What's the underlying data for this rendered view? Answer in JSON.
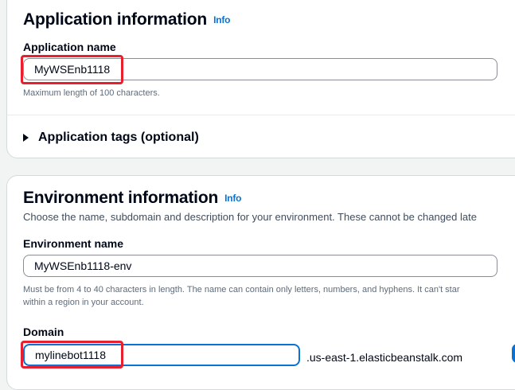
{
  "app_section": {
    "title": "Application information",
    "info_link": "Info",
    "name_label": "Application name",
    "name_value": "MyWSEnb1118",
    "name_hint": "Maximum length of 100 characters.",
    "tags_expander": "Application tags (optional)"
  },
  "env_section": {
    "title": "Environment information",
    "info_link": "Info",
    "description": "Choose the name, subdomain and description for your environment. These cannot be changed late",
    "name_label": "Environment name",
    "name_value": "MyWSEnb1118-env",
    "name_hint_line1": "Must be from 4 to 40 characters in length. The name can contain only letters, numbers, and hyphens. It can't star",
    "name_hint_line2": "within a region in your account.",
    "domain_label": "Domain",
    "domain_value": "mylinebot1118",
    "domain_suffix": ".us-east-1.elasticbeanstalk.com"
  },
  "colors": {
    "link": "#0972d3",
    "highlight": "#e8202d",
    "focus": "#0972d3"
  }
}
